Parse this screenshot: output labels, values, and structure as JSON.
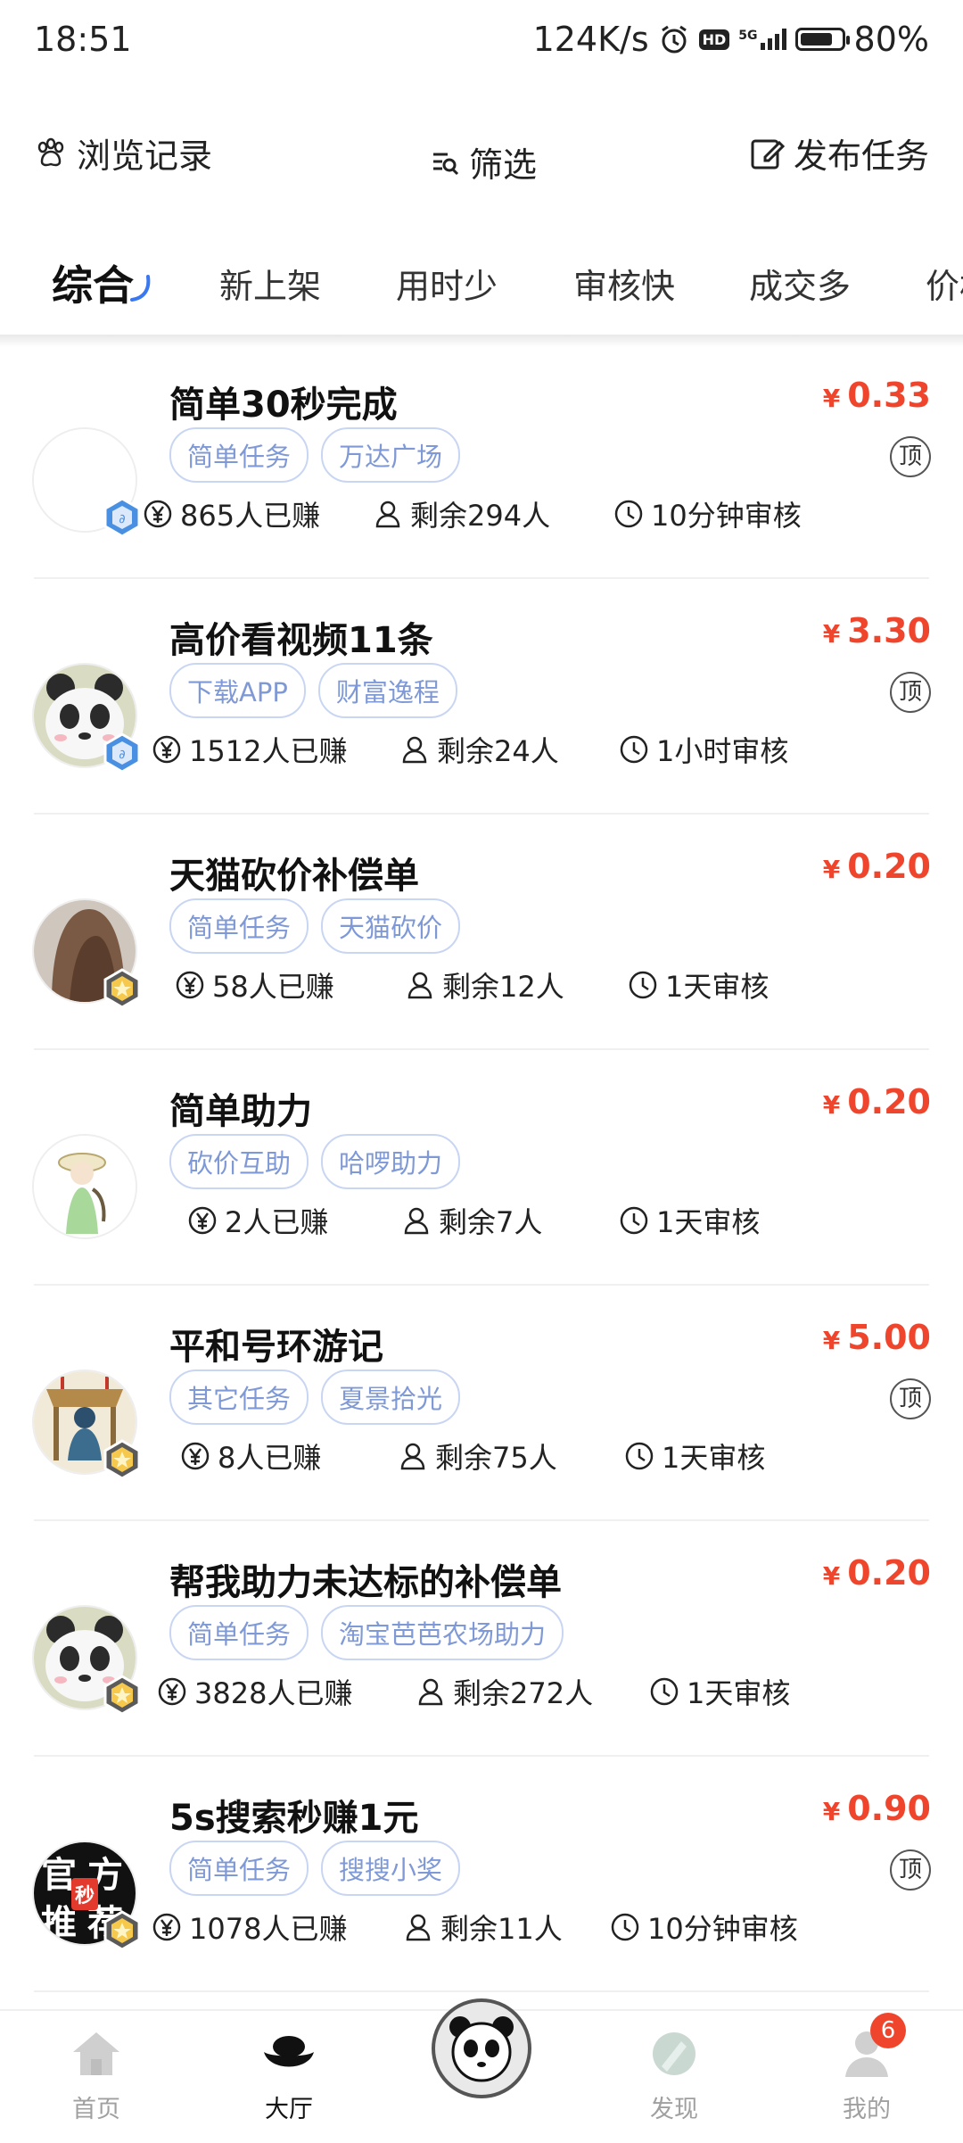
{
  "status_bar": {
    "time": "18:51",
    "net_speed": "124K/s",
    "signal_label": "5G",
    "battery": "80%",
    "battery_level": 0.8
  },
  "top_nav": {
    "history_label": "浏览记录",
    "filter_label": "筛选",
    "publish_label": "发布任务"
  },
  "tabs": [
    {
      "label": "综合",
      "active": true
    },
    {
      "label": "新上架"
    },
    {
      "label": "用时少"
    },
    {
      "label": "审核快"
    },
    {
      "label": "成交多"
    },
    {
      "label": "价格"
    }
  ],
  "tasks": [
    {
      "title": "简单30秒完成",
      "tags": [
        "简单任务",
        "万达广场"
      ],
      "currency": "¥",
      "price": "0.33",
      "pinned": true,
      "pin_label": "顶",
      "earned": "865人已赚",
      "remaining": "剩余294人",
      "review": "10分钟审核",
      "avatar": "blank",
      "badge": "blue"
    },
    {
      "title": "高价看视频11条",
      "tags": [
        "下载APP",
        "财富逸程"
      ],
      "currency": "¥",
      "price": "3.30",
      "pinned": true,
      "pin_label": "顶",
      "earned": "1512人已赚",
      "remaining": "剩余24人",
      "review": "1小时审核",
      "avatar": "panda",
      "badge": "blue"
    },
    {
      "title": "天猫砍价补偿单",
      "tags": [
        "简单任务",
        "天猫砍价"
      ],
      "currency": "¥",
      "price": "0.20",
      "pinned": false,
      "earned": "58人已赚",
      "remaining": "剩余12人",
      "review": "1天审核",
      "avatar": "photo-hair",
      "badge": "gold"
    },
    {
      "title": "简单助力",
      "tags": [
        "砍价互助",
        "哈啰助力"
      ],
      "currency": "¥",
      "price": "0.20",
      "pinned": false,
      "earned": "2人已赚",
      "remaining": "剩余7人",
      "review": "1天审核",
      "avatar": "photo-girl",
      "badge": "none"
    },
    {
      "title": "平和号环游记",
      "tags": [
        "其它任务",
        "夏景拾光"
      ],
      "currency": "¥",
      "price": "5.00",
      "pinned": true,
      "pin_label": "顶",
      "earned": "8人已赚",
      "remaining": "剩余75人",
      "review": "1天审核",
      "avatar": "photo-scene",
      "badge": "gold"
    },
    {
      "title": "帮我助力未达标的补偿单",
      "tags": [
        "简单任务",
        "淘宝芭芭农场助力"
      ],
      "currency": "¥",
      "price": "0.20",
      "pinned": false,
      "earned": "3828人已赚",
      "remaining": "剩余272人",
      "review": "1天审核",
      "avatar": "panda",
      "badge": "gold"
    },
    {
      "title": "5s搜索秒赚1元",
      "tags": [
        "简单任务",
        "搜搜小奖"
      ],
      "currency": "¥",
      "price": "0.90",
      "pinned": true,
      "pin_label": "顶",
      "earned": "1078人已赚",
      "remaining": "剩余11人",
      "review": "10分钟审核",
      "avatar": "official",
      "badge": "gold",
      "avatar_text": [
        "官",
        "方",
        "推",
        "荐"
      ],
      "avatar_stamp": "秒"
    }
  ],
  "bottom_nav": [
    {
      "label": "首页",
      "icon": "home-icon",
      "active": false
    },
    {
      "label": "大厅",
      "icon": "ingot-icon",
      "active": true
    },
    {
      "label": "",
      "icon": "panda-icon",
      "center": true
    },
    {
      "label": "发现",
      "icon": "discover-icon",
      "active": false
    },
    {
      "label": "我的",
      "icon": "profile-icon",
      "active": false,
      "badge": "6"
    }
  ],
  "colors": {
    "price": "#f0452d",
    "tag_border": "#c9d6f3",
    "tag_text": "#7f99d6"
  }
}
